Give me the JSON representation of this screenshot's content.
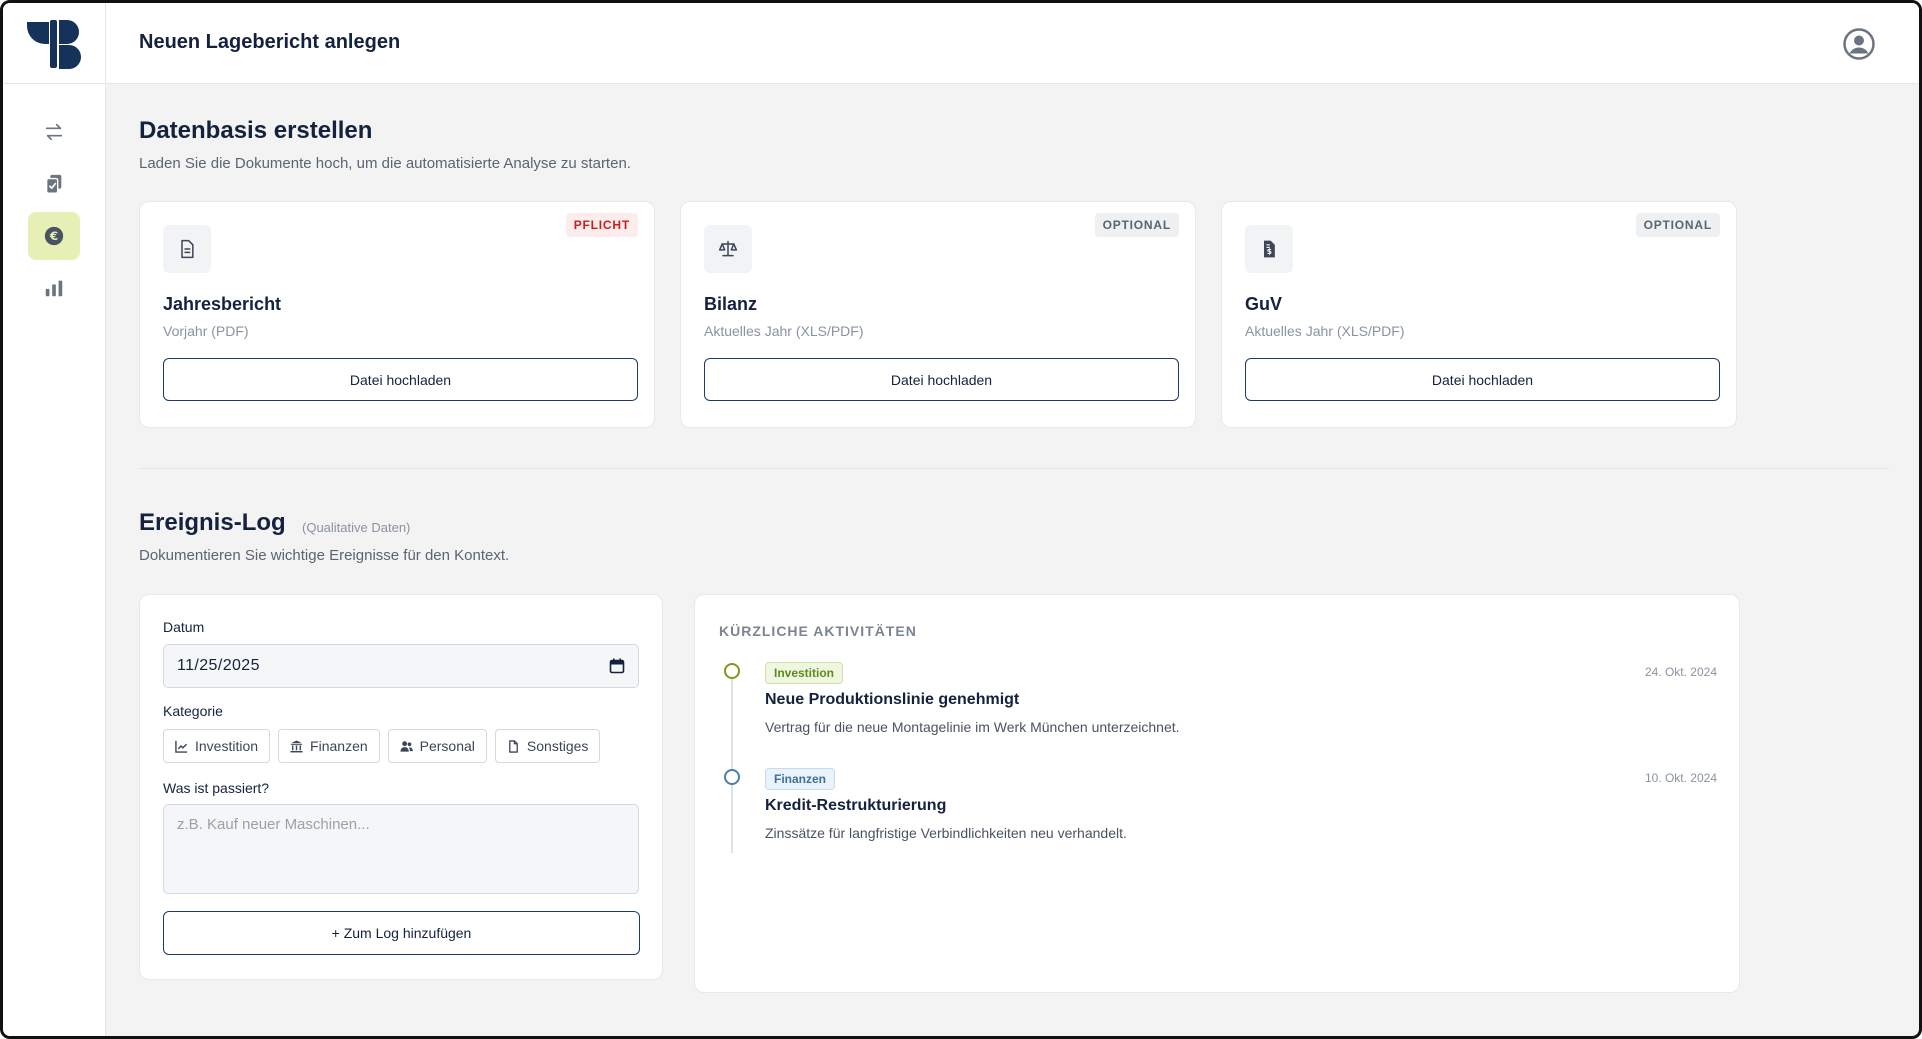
{
  "header": {
    "title": "Neuen Lagebericht anlegen"
  },
  "sidebar": {
    "items": [
      {
        "name": "transfer",
        "icon": "arrows-exchange-icon",
        "active": false
      },
      {
        "name": "documents",
        "icon": "clipboard-check-icon",
        "active": false
      },
      {
        "name": "finance",
        "icon": "euro-coin-icon",
        "active": true
      },
      {
        "name": "analytics",
        "icon": "bar-chart-icon",
        "active": false
      }
    ]
  },
  "colors": {
    "accent": "#e6efb5",
    "primary": "#1d3a68",
    "required": "#c81e1e"
  },
  "datenbasis": {
    "title": "Datenbasis erstellen",
    "subtitle": "Laden Sie die Dokumente hoch, um die automatisierte Analyse zu starten.",
    "cards": [
      {
        "icon": "document-icon",
        "badge": "PFLICHT",
        "title": "Jahresbericht",
        "subtitle": "Vorjahr (PDF)",
        "button": "Datei hochladen"
      },
      {
        "icon": "scale-icon",
        "badge": "OPTIONAL",
        "title": "Bilanz",
        "subtitle": "Aktuelles Jahr (XLS/PDF)",
        "button": "Datei hochladen"
      },
      {
        "icon": "invoice-dollar-icon",
        "badge": "OPTIONAL",
        "title": "GuV",
        "subtitle": "Aktuelles Jahr (XLS/PDF)",
        "button": "Datei hochladen"
      }
    ]
  },
  "log": {
    "title": "Ereignis-Log",
    "hint": "(Qualitative Daten)",
    "subtitle": "Dokumentieren Sie wichtige Ereignisse für den Kontext.",
    "form": {
      "date_label": "Datum",
      "date_value": "11/25/2025",
      "category_label": "Kategorie",
      "categories": [
        {
          "label": "Investition",
          "icon": "chart-line-icon"
        },
        {
          "label": "Finanzen",
          "icon": "bank-icon"
        },
        {
          "label": "Personal",
          "icon": "users-icon"
        },
        {
          "label": "Sonstiges",
          "icon": "file-icon"
        }
      ],
      "what_label": "Was ist passiert?",
      "what_placeholder": "z.B. Kauf neuer Maschinen...",
      "submit": "+ Zum Log hinzufügen"
    },
    "activities": {
      "heading": "KÜRZLICHE AKTIVITÄTEN",
      "items": [
        {
          "tag": "Investition",
          "date": "24. Okt. 2024",
          "title": "Neue Produktionslinie genehmigt",
          "description": "Vertrag für die neue Montagelinie im Werk München unterzeichnet."
        },
        {
          "tag": "Finanzen",
          "date": "10. Okt. 2024",
          "title": "Kredit-Restrukturierung",
          "description": "Zinssätze für langfristige Verbindlichkeiten neu verhandelt."
        }
      ]
    }
  }
}
